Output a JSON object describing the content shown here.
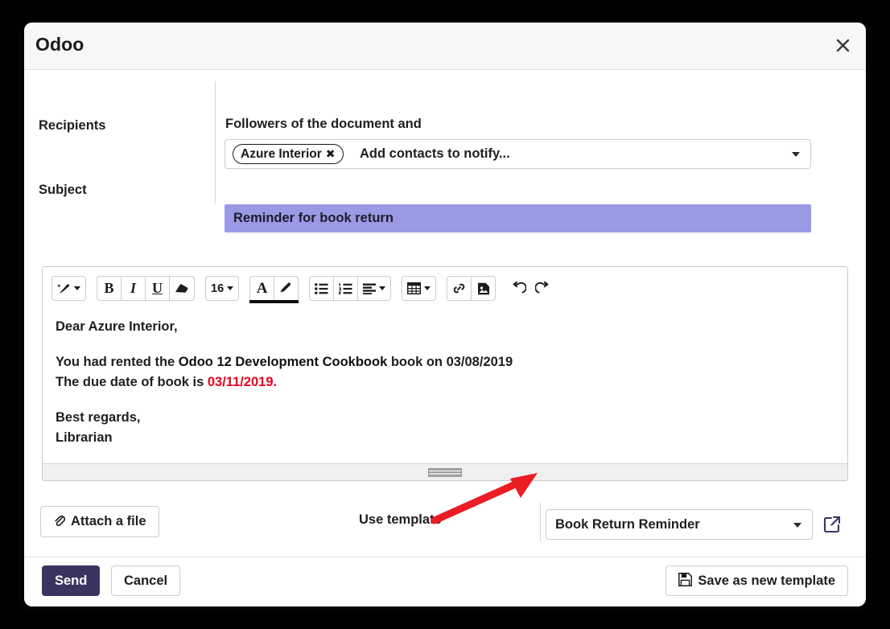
{
  "dialog": {
    "title": "Odoo",
    "close_icon": "close-icon"
  },
  "form": {
    "recipients_label": "Recipients",
    "followers_text": "Followers of the document and",
    "recipient_tags": [
      {
        "label": "Azure Interior",
        "remove_icon": "✖"
      }
    ],
    "recipients_placeholder": "Add contacts to notify...",
    "subject_label": "Subject",
    "subject_value": "Reminder for book return"
  },
  "editor": {
    "toolbar": [
      {
        "name": "style-picker-button",
        "glyph": "✒",
        "caret": true
      },
      {
        "name": "bold-button",
        "glyph": "B"
      },
      {
        "name": "italic-button",
        "glyph": "I"
      },
      {
        "name": "underline-button",
        "glyph": "U"
      },
      {
        "name": "clear-format-button",
        "glyph": "▰"
      },
      {
        "name": "font-size-button",
        "glyph": "16",
        "caret": true
      },
      {
        "name": "font-color-button",
        "glyph": "A"
      },
      {
        "name": "background-color-button",
        "glyph": "✎"
      },
      {
        "name": "unordered-list-button",
        "glyph": "☰"
      },
      {
        "name": "ordered-list-button",
        "glyph": "☰"
      },
      {
        "name": "align-button",
        "glyph": "☰",
        "caret": true
      },
      {
        "name": "table-button",
        "glyph": "▦",
        "caret": true
      },
      {
        "name": "link-button",
        "glyph": "ὑ7"
      },
      {
        "name": "image-button",
        "glyph": "ὛC"
      },
      {
        "name": "undo-button",
        "glyph": "↺"
      },
      {
        "name": "redo-button",
        "glyph": "↻"
      }
    ],
    "toolbar_font_size": "16",
    "body": {
      "greeting": "Dear Azure Interior,",
      "line1_prefix": "You had rented the ",
      "line1_book": "Odoo 12 Development Cookbook",
      "line1_suffix": " book on 03/08/2019",
      "line2_prefix": "The due date of book is ",
      "line2_date": "03/11/2019.",
      "signoff": "Best regards,",
      "signature": "Librarian"
    }
  },
  "attach_row": {
    "attach_label": "Attach a file",
    "attach_icon": "paperclip-icon",
    "use_template_label": "Use template",
    "template_value": "Book Return Reminder",
    "external_link_icon": "external-link-icon"
  },
  "footer": {
    "send_label": "Send",
    "cancel_label": "Cancel",
    "save_template_label": "Save as new template",
    "save_icon": "floppy-disk-icon"
  },
  "annotation": {
    "arrow_color": "#ec1c24",
    "points_to": "template-select"
  },
  "colors": {
    "accent_purple": "#3a3560",
    "subject_highlight": "#9a99e6",
    "due_date_red": "#e8001b",
    "annotation_red": "#ec1c24"
  }
}
